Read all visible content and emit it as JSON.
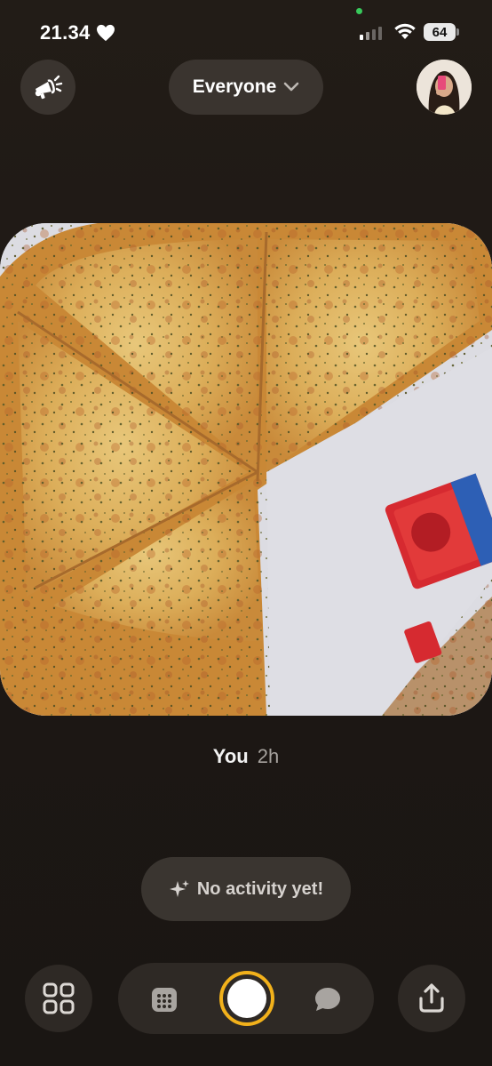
{
  "status_bar": {
    "time": "21.34",
    "battery": "64",
    "icons": [
      "heart-icon",
      "signal-icon",
      "wifi-icon",
      "battery-icon"
    ]
  },
  "header": {
    "audience_label": "Everyone",
    "left_icon": "megaphone-icon",
    "right_icon": "profile-avatar"
  },
  "post": {
    "author": "You",
    "time_ago": "2h",
    "image": "photo of a cheese pizza with a chili sauce packet"
  },
  "activity": {
    "label": "No activity yet!",
    "icon": "sparkle-icon"
  },
  "bottom_bar": {
    "icons": [
      "grid-icon",
      "calendar-icon",
      "shutter-button",
      "chat-icon",
      "share-icon"
    ],
    "accent": "#f2b11b"
  }
}
